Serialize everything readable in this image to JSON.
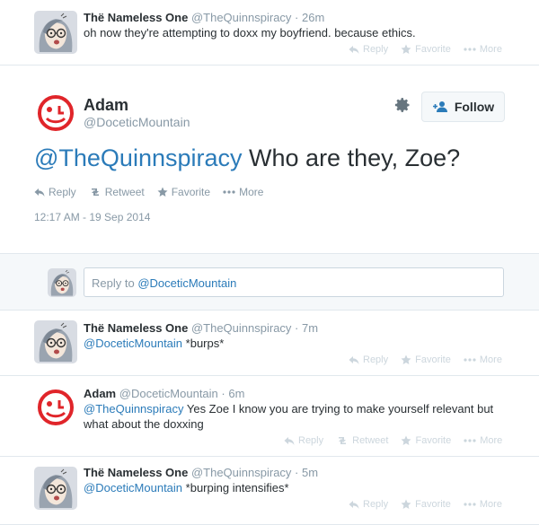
{
  "tweets": [
    {
      "name": "Thë Nameless One",
      "screen_name": "@TheQuinnspiracy",
      "time": "26m",
      "text": "oh now they're attempting to doxx my boyfriend. because ethics."
    },
    {
      "name": "Thë Nameless One",
      "screen_name": "@TheQuinnspiracy",
      "time": "7m",
      "mention": "@DoceticMountain",
      "text": "*burps*"
    },
    {
      "name": "Adam",
      "screen_name": "@DoceticMountain",
      "time": "6m",
      "mention": "@TheQuinnspiracy",
      "text": "Yes Zoe I know you are trying to make yourself relevant but",
      "text2": "what about the doxxing"
    },
    {
      "name": "Thë Nameless One",
      "screen_name": "@TheQuinnspiracy",
      "time": "5m",
      "mention": "@DoceticMountain",
      "text": "*burping intensifies*"
    }
  ],
  "main_tweet": {
    "name": "Adam",
    "screen_name": "@DoceticMountain",
    "mention": "@TheQuinnspiracy",
    "text": "Who are they, Zoe?",
    "timestamp": "12:17 AM - 19 Sep 2014",
    "follow_label": "Follow"
  },
  "actions": {
    "reply": "Reply",
    "retweet": "Retweet",
    "favorite": "Favorite",
    "more": "More"
  },
  "reply_box": {
    "prefix": "Reply to ",
    "mention": "@DoceticMountain"
  },
  "colors": {
    "link": "#2b7bb9",
    "avatar_red": "#e0252a",
    "border": "#e1e8ed",
    "reply_bg": "#f5f8fa"
  }
}
